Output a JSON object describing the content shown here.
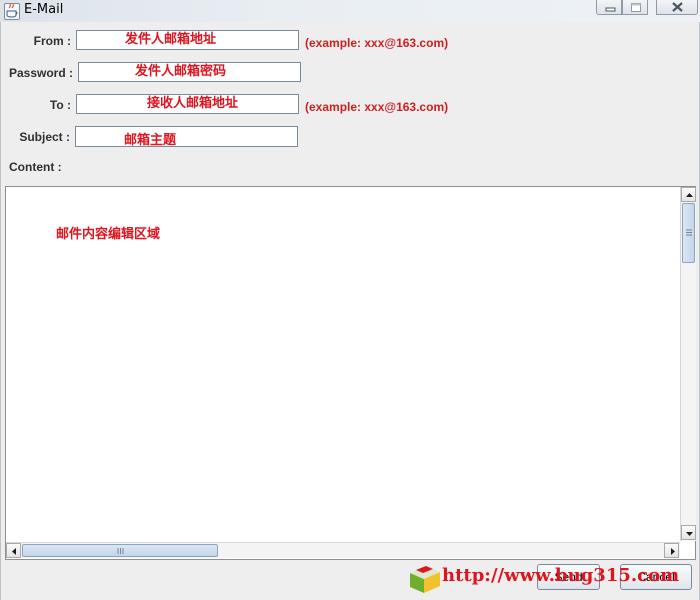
{
  "window": {
    "title": "E-Mail",
    "app_icon": "java-cup-icon",
    "controls": [
      "minimize-icon",
      "maximize-icon",
      "close-icon"
    ]
  },
  "form": {
    "from": {
      "label": "From :",
      "value": "发件人邮箱地址",
      "hint": "(example: xxx@163.com)"
    },
    "password": {
      "label": "Password :",
      "value": "发件人邮箱密码"
    },
    "to": {
      "label": "To :",
      "value": "接收人邮箱地址",
      "hint": "(example: xxx@163.com)"
    },
    "subject": {
      "label": "Subject :",
      "value": "邮箱主题"
    },
    "content": {
      "label": "Content :",
      "value": "邮件内容编辑区域"
    }
  },
  "buttons": {
    "send_label": "Send",
    "cancel_label": "Cancel"
  },
  "watermark": {
    "text": "http://www.bug315.com"
  },
  "colors": {
    "annotation_red": "#e0141e",
    "hint_red": "#cc1f1f",
    "panel_bg": "#eeeeee",
    "scroll_thumb": "#c4d6ea"
  }
}
